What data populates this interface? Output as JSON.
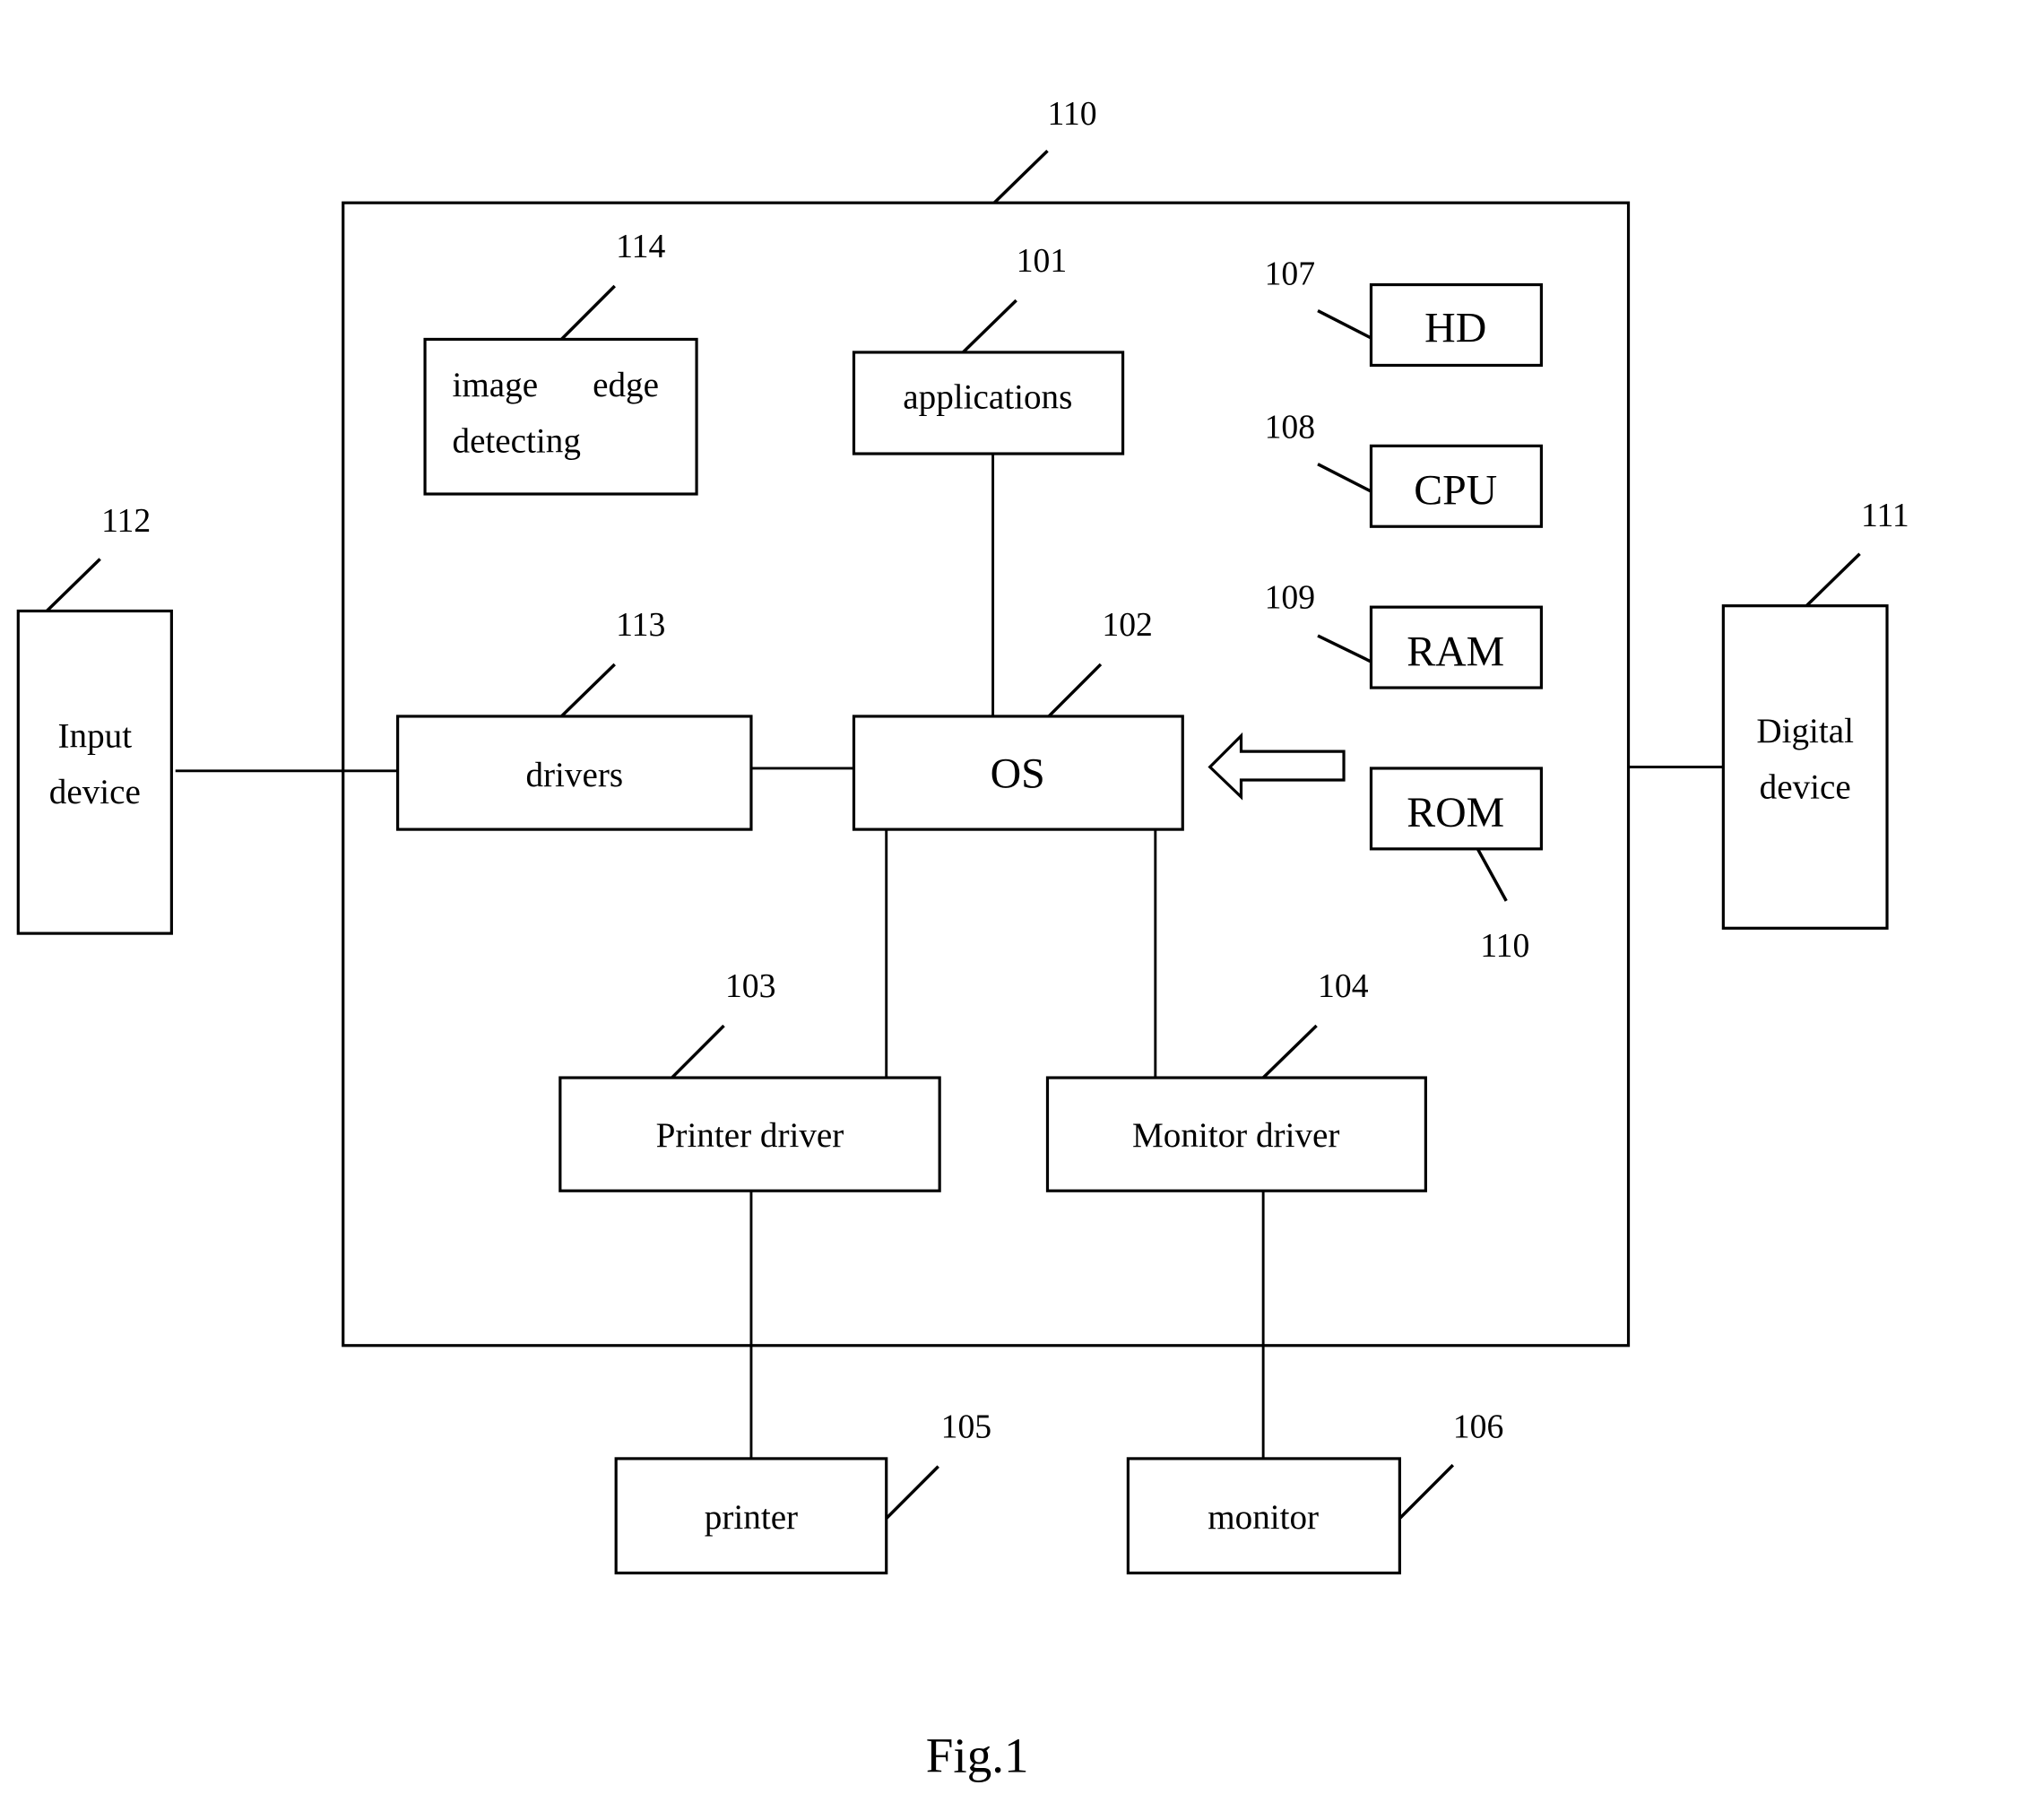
{
  "figure": {
    "caption": "Fig.1",
    "frame_ref": "110"
  },
  "blocks": {
    "image_edge": {
      "line1_a": "image",
      "line1_b": "edge",
      "line2": "detecting",
      "ref": "114"
    },
    "applications": {
      "label": "applications",
      "ref": "101"
    },
    "hd": {
      "label": "HD",
      "ref": "107"
    },
    "cpu": {
      "label": "CPU",
      "ref": "108"
    },
    "ram": {
      "label": "RAM",
      "ref": "109"
    },
    "rom": {
      "label": "ROM",
      "ref": "110"
    },
    "drivers": {
      "label": "drivers",
      "ref": "113"
    },
    "os": {
      "label": "OS",
      "ref": "102"
    },
    "printer_driver": {
      "label": "Printer driver",
      "ref": "103"
    },
    "monitor_driver": {
      "label": "Monitor driver",
      "ref": "104"
    },
    "printer": {
      "label": "printer",
      "ref": "105"
    },
    "monitor": {
      "label": "monitor",
      "ref": "106"
    },
    "input_device": {
      "line1": "Input",
      "line2": "device",
      "ref": "112"
    },
    "digital_device": {
      "line1": "Digital",
      "line2": "device",
      "ref": "111"
    }
  }
}
